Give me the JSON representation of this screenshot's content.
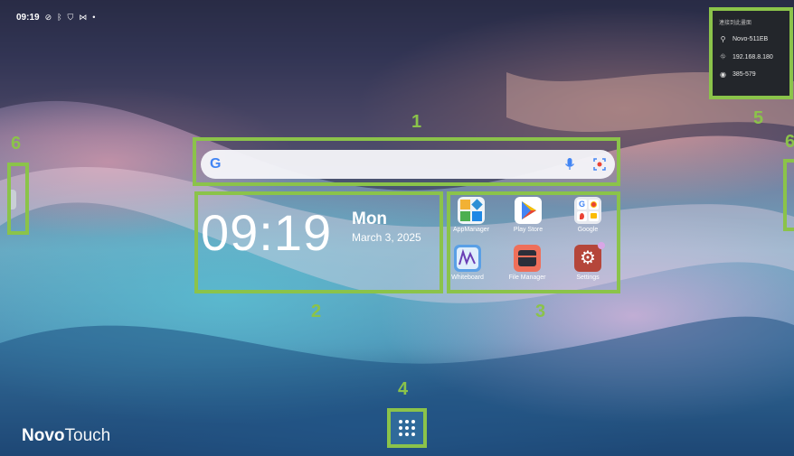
{
  "status_bar": {
    "time": "09:19",
    "icons": [
      "check-circle-icon",
      "bluetooth-icon",
      "shield-icon",
      "cast-icon",
      "dot-icon"
    ]
  },
  "search": {
    "placeholder": ""
  },
  "clock": {
    "time": "09:19",
    "day": "Mon",
    "date": "March 3, 2025"
  },
  "apps": [
    {
      "label": "AppManager",
      "icon": "app-manager-icon"
    },
    {
      "label": "Play Store",
      "icon": "play-store-icon"
    },
    {
      "label": "Google",
      "icon": "google-folder-icon"
    },
    {
      "label": "Whiteboard",
      "icon": "whiteboard-icon"
    },
    {
      "label": "File Manager",
      "icon": "file-manager-icon"
    },
    {
      "label": "Settings",
      "icon": "settings-icon"
    }
  ],
  "info_panel": {
    "header": "連接到此畫面",
    "device_name": "Novo-511EB",
    "ip": "192.168.8.180",
    "pin": "385-579"
  },
  "annotations": [
    "1",
    "2",
    "3",
    "4",
    "5",
    "6",
    "6"
  ],
  "brand": {
    "bold": "Novo",
    "light": "Touch"
  },
  "colors": {
    "annotation": "#8bc34a",
    "panel_bg": "#23262b"
  }
}
